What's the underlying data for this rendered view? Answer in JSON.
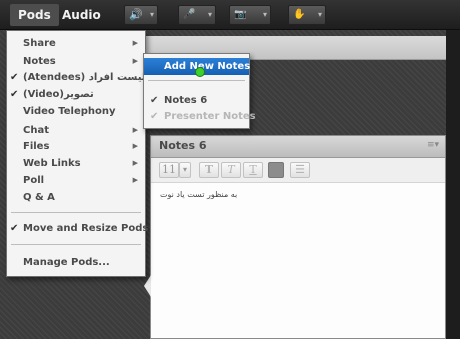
{
  "topbar": {
    "tabs": [
      {
        "label": "Pods",
        "active": true
      },
      {
        "label": "Audio",
        "active": false
      }
    ],
    "tools": [
      {
        "icon": "speaker-icon",
        "glyph": "🔊",
        "color": "#37c23a"
      },
      {
        "icon": "microphone-icon",
        "glyph": "🎤"
      },
      {
        "icon": "webcam-icon",
        "glyph": "📷"
      },
      {
        "icon": "raise-hand-icon",
        "glyph": "✋"
      }
    ]
  },
  "pods_menu": {
    "items": [
      {
        "label": "Share",
        "checked": false,
        "submenu": true
      },
      {
        "label": "Notes",
        "checked": false,
        "submenu": true
      },
      {
        "label": "(Atendees) لیست افراد",
        "checked": true,
        "submenu": false
      },
      {
        "label": "(Video)تصویر",
        "checked": true,
        "submenu": false
      },
      {
        "label": "Video Telephony",
        "checked": false,
        "submenu": false
      },
      {
        "label": "Chat",
        "checked": false,
        "submenu": true
      },
      {
        "label": "Files",
        "checked": false,
        "submenu": true
      },
      {
        "label": "Web Links",
        "checked": false,
        "submenu": true
      },
      {
        "label": "Poll",
        "checked": false,
        "submenu": true
      },
      {
        "label": "Q & A",
        "checked": false,
        "submenu": false
      },
      {
        "label": "Move and Resize Pods",
        "checked": true,
        "submenu": false
      },
      {
        "label": "Manage Pods...",
        "checked": false,
        "submenu": false
      }
    ]
  },
  "notes_submenu": {
    "add_new": "Add New Notes",
    "items": [
      {
        "label": "Notes 6",
        "checked": true,
        "disabled": false
      },
      {
        "label": "Presenter Notes",
        "checked": true,
        "disabled": true
      }
    ]
  },
  "notes_pod": {
    "title": "Notes 6",
    "options_glyph": "≡▾",
    "toolbar": {
      "font_size": "11",
      "font_size_caret": "▾",
      "bold": "T",
      "italic": "T",
      "underline": "T",
      "list_glyph": "☰"
    },
    "content": "به منظور تست یاد نوت"
  },
  "glyphs": {
    "check": "✔",
    "submenu_arrow": "▶",
    "dropdown_caret": "▾"
  }
}
